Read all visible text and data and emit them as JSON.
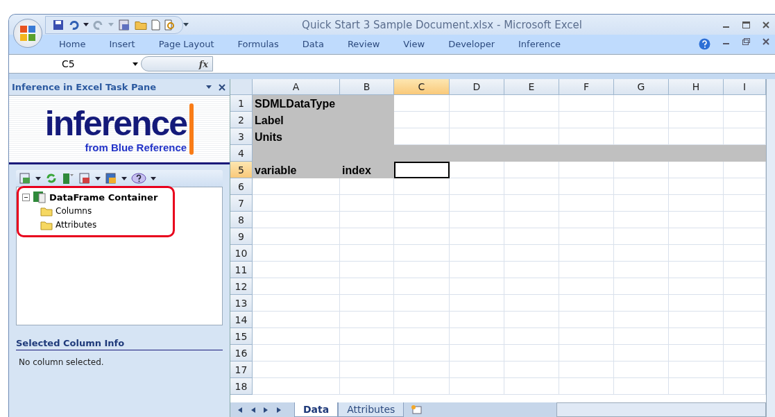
{
  "window": {
    "title": "Quick Start 3 Sample Document.xlsx - Microsoft Excel"
  },
  "ribbon_tabs": [
    "Home",
    "Insert",
    "Page Layout",
    "Formulas",
    "Data",
    "Review",
    "View",
    "Developer",
    "Inference"
  ],
  "formula_bar": {
    "name_box": "C5",
    "fx_label": "fx"
  },
  "task_pane": {
    "title": "Inference in Excel Task Pane",
    "logo": {
      "wordmark": "inference",
      "tagline": "from Blue Reference"
    },
    "tree": [
      {
        "label": "DataFrame Container",
        "expanded": true,
        "children": [
          {
            "label": "Columns"
          },
          {
            "label": "Attributes"
          }
        ]
      }
    ],
    "info_title": "Selected Column Info",
    "info_text": "No column selected."
  },
  "sheet": {
    "columns": [
      {
        "label": "A",
        "selected": false
      },
      {
        "label": "B",
        "selected": false
      },
      {
        "label": "C",
        "selected": true
      },
      {
        "label": "D",
        "selected": false
      },
      {
        "label": "E",
        "selected": false
      },
      {
        "label": "F",
        "selected": false
      },
      {
        "label": "G",
        "selected": false
      },
      {
        "label": "H",
        "selected": false
      },
      {
        "label": "I",
        "selected": false
      }
    ],
    "rows": [
      {
        "label": "1",
        "selected": false,
        "label_shaded": true,
        "full_shaded": false,
        "cells": [
          "SDMLDataType"
        ]
      },
      {
        "label": "2",
        "selected": false,
        "label_shaded": true,
        "full_shaded": false,
        "cells": [
          "Label"
        ]
      },
      {
        "label": "3",
        "selected": false,
        "label_shaded": true,
        "full_shaded": false,
        "cells": [
          "Units"
        ]
      },
      {
        "label": "4",
        "selected": false,
        "label_shaded": true,
        "full_shaded": true,
        "cells": []
      },
      {
        "label": "5",
        "selected": true,
        "label_shaded": true,
        "full_shaded": false,
        "cells": [
          "variable",
          "index"
        ]
      },
      {
        "label": "6",
        "selected": false,
        "label_shaded": false,
        "full_shaded": false,
        "cells": []
      },
      {
        "label": "7",
        "selected": false,
        "label_shaded": false,
        "full_shaded": false,
        "cells": []
      },
      {
        "label": "8",
        "selected": false,
        "label_shaded": false,
        "full_shaded": false,
        "cells": []
      },
      {
        "label": "9",
        "selected": false,
        "label_shaded": false,
        "full_shaded": false,
        "cells": []
      },
      {
        "label": "10",
        "selected": false,
        "label_shaded": false,
        "full_shaded": false,
        "cells": []
      },
      {
        "label": "11",
        "selected": false,
        "label_shaded": false,
        "full_shaded": false,
        "cells": []
      },
      {
        "label": "12",
        "selected": false,
        "label_shaded": false,
        "full_shaded": false,
        "cells": []
      },
      {
        "label": "13",
        "selected": false,
        "label_shaded": false,
        "full_shaded": false,
        "cells": []
      },
      {
        "label": "14",
        "selected": false,
        "label_shaded": false,
        "full_shaded": false,
        "cells": []
      },
      {
        "label": "15",
        "selected": false,
        "label_shaded": false,
        "full_shaded": false,
        "cells": []
      },
      {
        "label": "16",
        "selected": false,
        "label_shaded": false,
        "full_shaded": false,
        "cells": []
      },
      {
        "label": "17",
        "selected": false,
        "label_shaded": false,
        "full_shaded": false,
        "cells": []
      },
      {
        "label": "18",
        "selected": false,
        "label_shaded": false,
        "full_shaded": false,
        "cells": []
      }
    ],
    "sheet_tabs": [
      {
        "label": "Data",
        "selected": true
      },
      {
        "label": "Attributes",
        "selected": false
      }
    ]
  }
}
